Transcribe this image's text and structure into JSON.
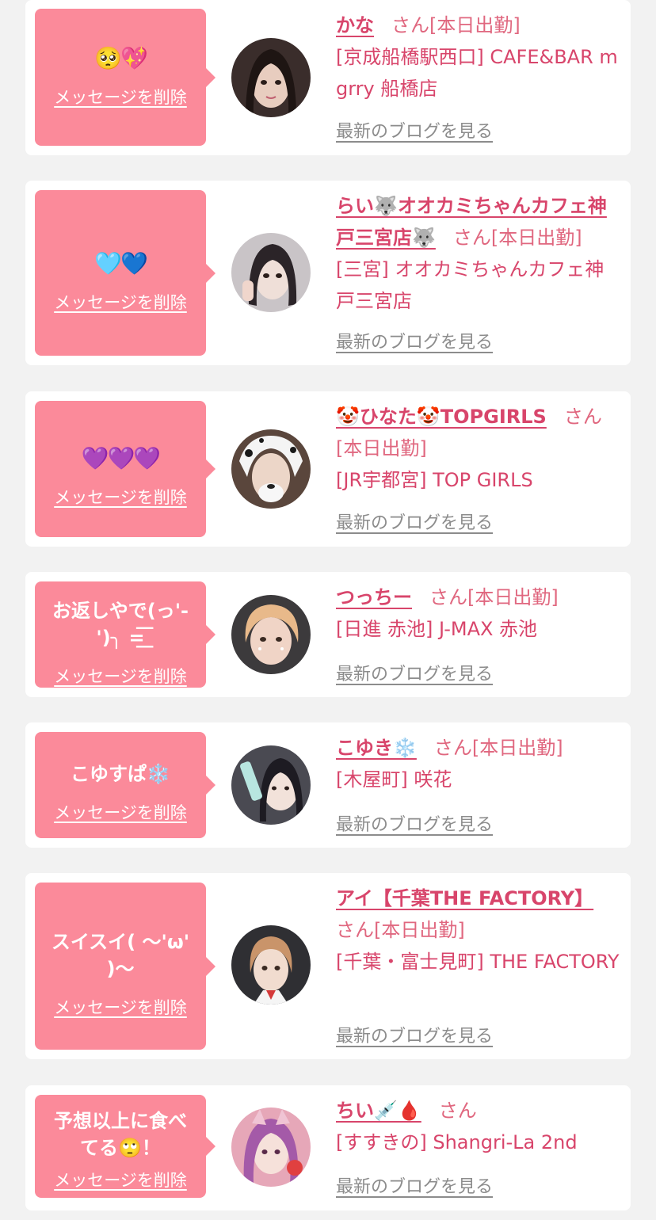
{
  "delete_label": "メッセージを削除",
  "blog_label": "最新のブログを見る",
  "colors": {
    "page_background": "#f2f2f2",
    "card_background": "#ffffff",
    "bubble_pink": "#fb8a9a",
    "name_link": "#d8456b",
    "muted_link": "#8c8c8c"
  },
  "cards": [
    {
      "message": "🥺💖",
      "name": "かな",
      "honorific": "さん",
      "status": "[本日出勤]",
      "shop": "[京成船橋駅西口] CAFE&BAR mgrry 船橋店"
    },
    {
      "message": "🩵💙",
      "name": "らい🐺オオカミちゃんカフェ神戸三宮店🐺",
      "honorific": "さん",
      "status": "[本日出勤]",
      "shop": "[三宮] オオカミちゃんカフェ神戸三宮店"
    },
    {
      "message": "💜💜💜",
      "name": "🤡ひなた🤡TOPGIRLS",
      "honorific": "さん",
      "status": "[本日出勤]",
      "shop": "[JR宇都宮] TOP GIRLS"
    },
    {
      "message": "お返しやで(っ'-')╮ =͟͟͞͞",
      "name": "つっちー",
      "honorific": "さん",
      "status": "[本日出勤]",
      "shop": "[日進 赤池] J-MAX 赤池"
    },
    {
      "message": "こゆすぱ❄️",
      "name": "こゆき❄️",
      "honorific": "さん",
      "status": "[本日出勤]",
      "shop": "[木屋町] 咲花"
    },
    {
      "message": "スイスイ( ～'ω' )～",
      "name": "アイ【千葉THE FACTORY】",
      "honorific": "さん",
      "status": "[本日出勤]",
      "shop": "[千葉・富士見町] THE FACTORY"
    },
    {
      "message": "予想以上に食べてる🙄！",
      "name": "ちい💉🩸",
      "honorific": "さん",
      "status": "",
      "shop": "[すすきの] Shangri-La 2nd"
    }
  ]
}
